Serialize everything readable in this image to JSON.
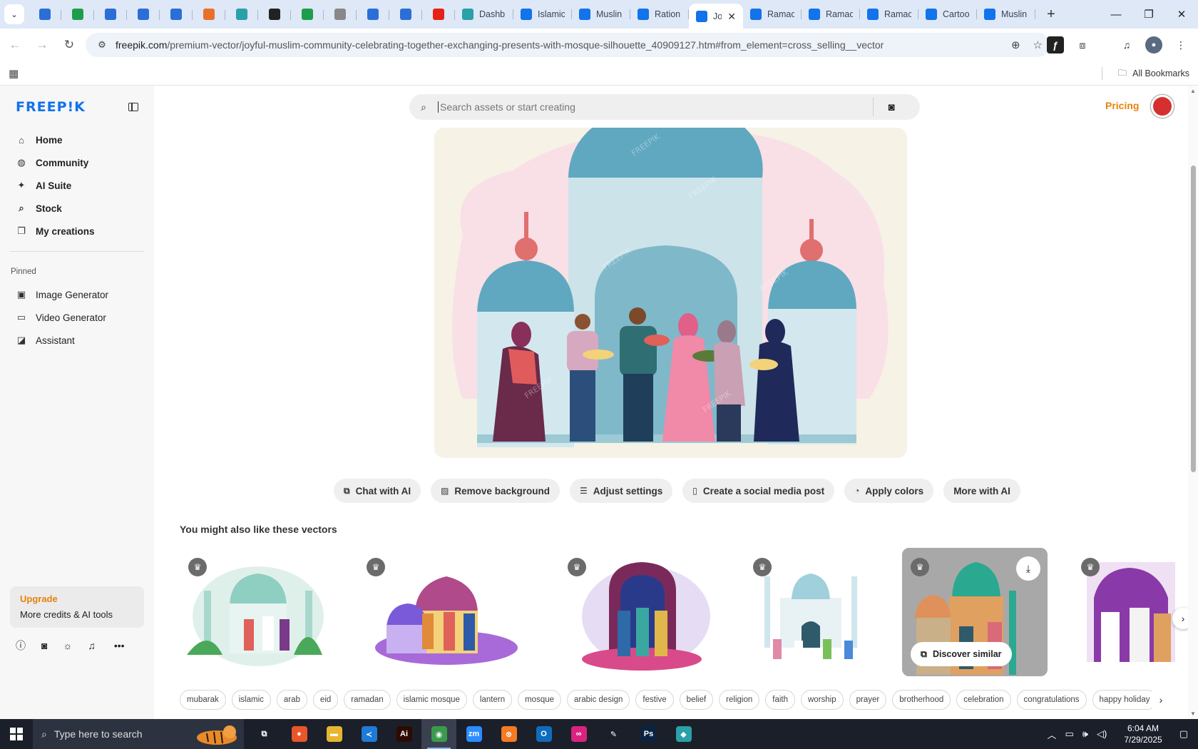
{
  "browser": {
    "tabs_pinned": [
      {
        "icon": "browser-ext-icon",
        "color": "#2b6fd6"
      },
      {
        "icon": "sheets-icon",
        "color": "#1e9e4a"
      },
      {
        "icon": "docs-icon",
        "color": "#2b6fd6"
      },
      {
        "icon": "docs-icon",
        "color": "#2b6fd6"
      },
      {
        "icon": "docs-icon",
        "color": "#2b6fd6"
      },
      {
        "icon": "orange-app-icon",
        "color": "#e8702a"
      },
      {
        "icon": "teal-app-icon",
        "color": "#2aa0a8"
      },
      {
        "icon": "openai-icon",
        "color": "#222222"
      },
      {
        "icon": "sheets-icon",
        "color": "#1e9e4a"
      },
      {
        "icon": "globe-icon",
        "color": "#888888"
      },
      {
        "icon": "qr-icon",
        "color": "#2b6fd6"
      },
      {
        "icon": "forms-icon",
        "color": "#2b6fd6"
      },
      {
        "icon": "youtube-icon",
        "color": "#e62117"
      }
    ],
    "tabs": [
      {
        "title": "Dashb",
        "icon": "teal-app-icon",
        "color": "#2aa0a8"
      },
      {
        "title": "Islamic",
        "icon": "freepik-icon",
        "color": "#1273eb"
      },
      {
        "title": "Muslin",
        "icon": "freepik-icon",
        "color": "#1273eb"
      },
      {
        "title": "Ration",
        "icon": "freepik-icon",
        "color": "#1273eb"
      },
      {
        "title": "Jo",
        "icon": "freepik-icon",
        "color": "#1273eb",
        "active": true
      },
      {
        "title": "Ramac",
        "icon": "freepik-icon",
        "color": "#1273eb"
      },
      {
        "title": "Ramac",
        "icon": "freepik-icon",
        "color": "#1273eb"
      },
      {
        "title": "Ramac",
        "icon": "freepik-icon",
        "color": "#1273eb"
      },
      {
        "title": "Cartoo",
        "icon": "freepik-icon",
        "color": "#1273eb"
      },
      {
        "title": "Muslin",
        "icon": "freepik-icon",
        "color": "#1273eb"
      }
    ],
    "url_host": "freepik.com",
    "url_path": "/premium-vector/joyful-muslim-community-celebrating-together-exchanging-presents-with-mosque-silhouette_40909127.htm#from_element=cross_selling__vector",
    "all_bookmarks": "All Bookmarks"
  },
  "sidebar": {
    "logo": "FREEP!K",
    "nav": [
      {
        "label": "Home",
        "icon": "home-icon",
        "glyph": "⌂"
      },
      {
        "label": "Community",
        "icon": "globe-icon",
        "glyph": "◍"
      },
      {
        "label": "AI Suite",
        "icon": "sparkle-icon",
        "glyph": "✦"
      },
      {
        "label": "Stock",
        "icon": "search-icon",
        "glyph": "⌕"
      },
      {
        "label": "My creations",
        "icon": "layers-icon",
        "glyph": "❐"
      }
    ],
    "pinned_heading": "Pinned",
    "pinned": [
      {
        "label": "Image Generator",
        "icon": "image-icon",
        "glyph": "▣"
      },
      {
        "label": "Video Generator",
        "icon": "video-icon",
        "glyph": "▭"
      },
      {
        "label": "Assistant",
        "icon": "chat-icon",
        "glyph": "◪"
      }
    ],
    "upgrade_title": "Upgrade",
    "upgrade_sub": "More credits & AI tools"
  },
  "main": {
    "search_placeholder": "Search assets or start creating",
    "pricing": "Pricing",
    "ai_actions": [
      {
        "label": "Chat with AI",
        "icon": "chat-ai-icon",
        "glyph": "⧉"
      },
      {
        "label": "Remove background",
        "icon": "remove-bg-icon",
        "glyph": "▨"
      },
      {
        "label": "Adjust settings",
        "icon": "sliders-icon",
        "glyph": "☰"
      },
      {
        "label": "Create a social media post",
        "icon": "phone-icon",
        "glyph": "▯"
      },
      {
        "label": "Apply colors",
        "icon": "palette-icon",
        "glyph": "◔"
      },
      {
        "label": "More with AI",
        "icon": "",
        "glyph": ""
      }
    ],
    "similar_title": "You might also like these vectors",
    "discover_similar": "Discover similar",
    "tags": [
      "mubarak",
      "islamic",
      "arab",
      "eid",
      "ramadan",
      "islamic mosque",
      "lantern",
      "mosque",
      "arabic design",
      "festive",
      "belief",
      "religion",
      "faith",
      "worship",
      "prayer",
      "brotherhood",
      "celebration",
      "congratulations",
      "happy holiday"
    ]
  },
  "taskbar": {
    "search_placeholder": "Type here to search",
    "apps": [
      {
        "name": "task-view-icon",
        "color": "#1b1f2a",
        "glyph": "⧉"
      },
      {
        "name": "firefox-icon",
        "color": "#e8562a",
        "glyph": "●"
      },
      {
        "name": "file-explorer-icon",
        "color": "#e8b530",
        "glyph": "▬"
      },
      {
        "name": "vscode-icon",
        "color": "#1f7bd6",
        "glyph": "≺"
      },
      {
        "name": "illustrator-icon",
        "color": "#2d0a02",
        "glyph": "Ai"
      },
      {
        "name": "chrome-icon",
        "color": "#3a9b4c",
        "glyph": "◉",
        "active": true
      },
      {
        "name": "zoom-icon",
        "color": "#2d8cff",
        "glyph": "zm"
      },
      {
        "name": "xampp-icon",
        "color": "#f57a22",
        "glyph": "⊗"
      },
      {
        "name": "outlook-icon",
        "color": "#0f6cbd",
        "glyph": "O"
      },
      {
        "name": "creative-cloud-icon",
        "color": "#d9247f",
        "glyph": "∞"
      },
      {
        "name": "pen-tool-icon",
        "color": "#1b1f2a",
        "glyph": "✎"
      },
      {
        "name": "photoshop-icon",
        "color": "#0a2342",
        "glyph": "Ps"
      },
      {
        "name": "teal-app-icon",
        "color": "#2aa0a8",
        "glyph": "◆"
      }
    ],
    "time": "6:04 AM",
    "date": "7/29/2025"
  }
}
